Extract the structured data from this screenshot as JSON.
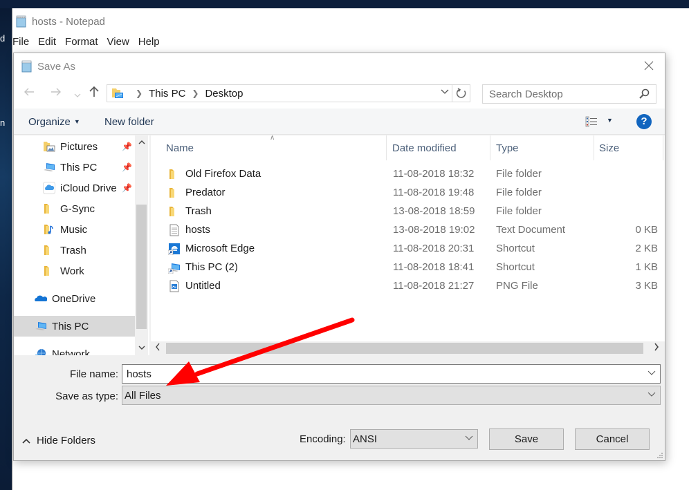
{
  "desktop": {
    "left_text_fragments": [
      "d",
      "n"
    ]
  },
  "notepad": {
    "title": "hosts - Notepad",
    "icon": "notepad-icon",
    "menu": [
      "File",
      "Edit",
      "Format",
      "View",
      "Help"
    ]
  },
  "dialog": {
    "title": "Save As",
    "icon": "notepad-icon",
    "close_icon": "close-icon",
    "nav": {
      "back_icon": "arrow-left-icon",
      "forward_icon": "arrow-right-icon",
      "recent_icon": "chevron-down-icon",
      "up_icon": "arrow-up-icon"
    },
    "address": {
      "icon": "this-pc-folder-icon",
      "crumbs": [
        "This PC",
        "Desktop"
      ],
      "refresh_icon": "refresh-icon"
    },
    "search": {
      "placeholder": "Search Desktop",
      "icon": "search-icon"
    },
    "toolbar": {
      "organize": "Organize",
      "new_folder": "New folder",
      "view_icon": "details-view-icon",
      "help_label": "?"
    },
    "nav_pane": {
      "items": [
        {
          "label": "Pictures",
          "icon": "pictures-folder-icon",
          "pinned": true
        },
        {
          "label": "This PC",
          "icon": "computer-icon",
          "pinned": true
        },
        {
          "label": "iCloud Drive",
          "icon": "icloud-icon",
          "pinned": true
        },
        {
          "label": "G-Sync",
          "icon": "folder-icon",
          "pinned": false
        },
        {
          "label": "Music",
          "icon": "music-folder-icon",
          "pinned": false
        },
        {
          "label": "Trash",
          "icon": "folder-icon",
          "pinned": false
        },
        {
          "label": "Work",
          "icon": "folder-icon",
          "pinned": false
        },
        {
          "label": "OneDrive",
          "icon": "onedrive-icon",
          "pinned": false
        },
        {
          "label": "This PC",
          "icon": "computer-icon",
          "pinned": false,
          "selected": true
        },
        {
          "label": "Network",
          "icon": "network-icon",
          "pinned": false
        }
      ],
      "pin_glyph": "📌"
    },
    "file_list": {
      "columns": [
        "Name",
        "Date modified",
        "Type",
        "Size"
      ],
      "sorted_by": "Name",
      "rows": [
        {
          "name": "Old Firefox Data",
          "date": "11-08-2018 18:32",
          "type": "File folder",
          "size": "",
          "icon": "folder-icon"
        },
        {
          "name": "Predator",
          "date": "11-08-2018 19:48",
          "type": "File folder",
          "size": "",
          "icon": "folder-icon"
        },
        {
          "name": "Trash",
          "date": "13-08-2018 18:59",
          "type": "File folder",
          "size": "",
          "icon": "folder-icon"
        },
        {
          "name": "hosts",
          "date": "13-08-2018 19:02",
          "type": "Text Document",
          "size": "0 KB",
          "icon": "text-document-icon"
        },
        {
          "name": "Microsoft Edge",
          "date": "11-08-2018 20:31",
          "type": "Shortcut",
          "size": "2 KB",
          "icon": "edge-shortcut-icon"
        },
        {
          "name": "This PC (2)",
          "date": "11-08-2018 18:41",
          "type": "Shortcut",
          "size": "1 KB",
          "icon": "computer-shortcut-icon"
        },
        {
          "name": "Untitled",
          "date": "11-08-2018 21:27",
          "type": "PNG File",
          "size": "3 KB",
          "icon": "png-file-icon"
        }
      ]
    },
    "file_name": {
      "label": "File name:",
      "value": "hosts"
    },
    "save_as_type": {
      "label": "Save as type:",
      "value": "All Files"
    },
    "hide_folders": "Hide Folders",
    "encoding": {
      "label": "Encoding:",
      "value": "ANSI"
    },
    "buttons": {
      "save": "Save",
      "cancel": "Cancel"
    }
  },
  "annotation": {
    "type": "arrow",
    "color": "#ff0000",
    "points_to": "save-as-type-select"
  },
  "colors": {
    "help_blue": "#1165bf",
    "toolbar_text": "#1e3553",
    "header_text": "#4c607a",
    "selected_nav": "#d9d9d9"
  }
}
